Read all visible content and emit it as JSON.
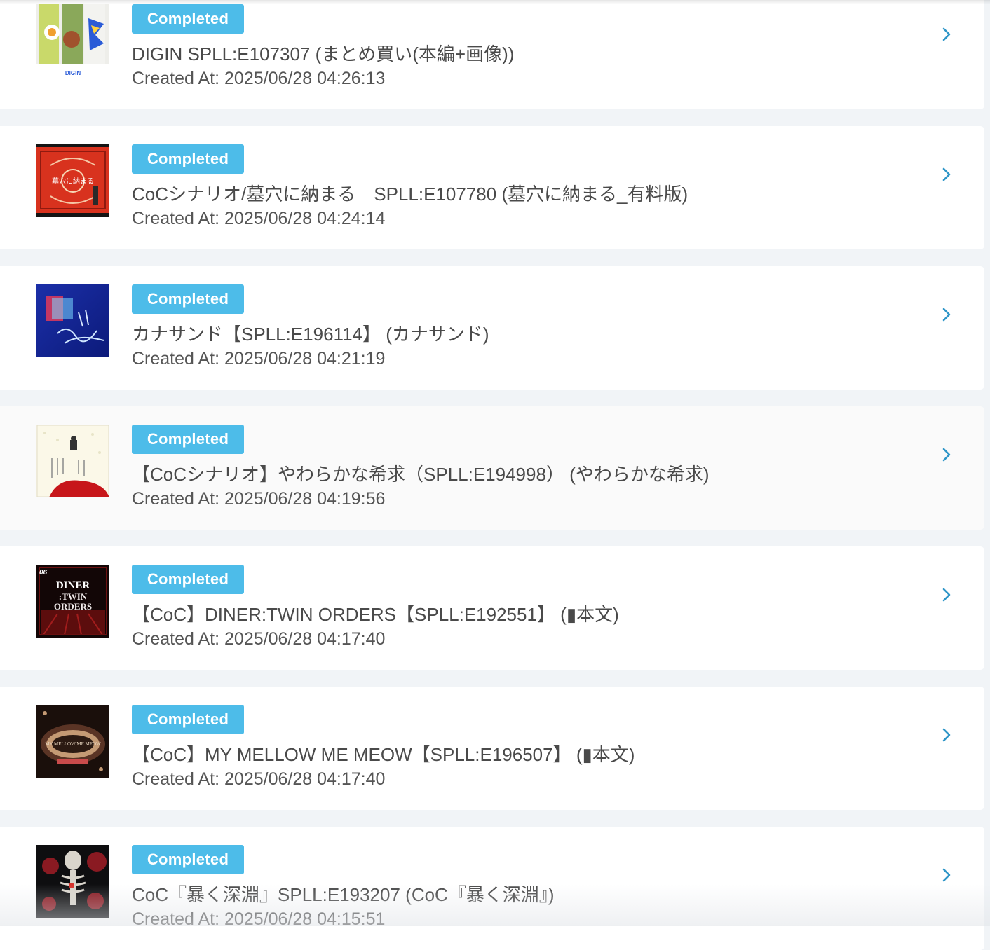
{
  "orders": [
    {
      "status": "Completed",
      "title": "DIGIN SPLL:E107307 (まとめ買い(本編+画像))",
      "created_label": "Created At:",
      "created_at": "2025/06/28 04:26:13",
      "thumbnail": "digin-cover-image"
    },
    {
      "status": "Completed",
      "title": "CoCシナリオ/墓穴に納まる　SPLL:E107780 (墓穴に納まる_有料版)",
      "created_label": "Created At:",
      "created_at": "2025/06/28 04:24:14",
      "thumbnail": "red-ornate-cover-image"
    },
    {
      "status": "Completed",
      "title": "カナサンド【SPLL:E196114】 (カナサンド)",
      "created_label": "Created At:",
      "created_at": "2025/06/28 04:21:19",
      "thumbnail": "blue-neon-cover-image"
    },
    {
      "status": "Completed",
      "title": "【CoCシナリオ】やわらかな希求（SPLL:E194998） (やわらかな希求)",
      "created_label": "Created At:",
      "created_at": "2025/06/28 04:19:56",
      "thumbnail": "white-red-cover-image"
    },
    {
      "status": "Completed",
      "title": "【CoC】DINER:TWIN ORDERS【SPLL:E192551】 (▮本文)",
      "created_label": "Created At:",
      "created_at": "2025/06/28 04:17:40",
      "thumbnail": "diner-cover-image",
      "thumb_text": [
        "06",
        "DINER",
        ":TWIN",
        "ORDERS"
      ]
    },
    {
      "status": "Completed",
      "title": "【CoC】MY MELLOW ME MEOW【SPLL:E196507】 (▮本文)",
      "created_label": "Created At:",
      "created_at": "2025/06/28 04:17:40",
      "thumbnail": "mellow-cover-image"
    },
    {
      "status": "Completed",
      "title": "CoC『暴く深淵』SPLL:E193207 (CoC『暴く深淵』)",
      "created_label": "Created At:",
      "created_at": "2025/06/28 04:15:51",
      "thumbnail": "skeleton-cover-image"
    }
  ],
  "colors": {
    "badge": "#4dbce9",
    "chevron": "#2f96c8",
    "page_bg": "#f1f4f7",
    "title_text": "#4a4a4a"
  },
  "icons": {
    "row_action": "chevron-right-icon"
  }
}
